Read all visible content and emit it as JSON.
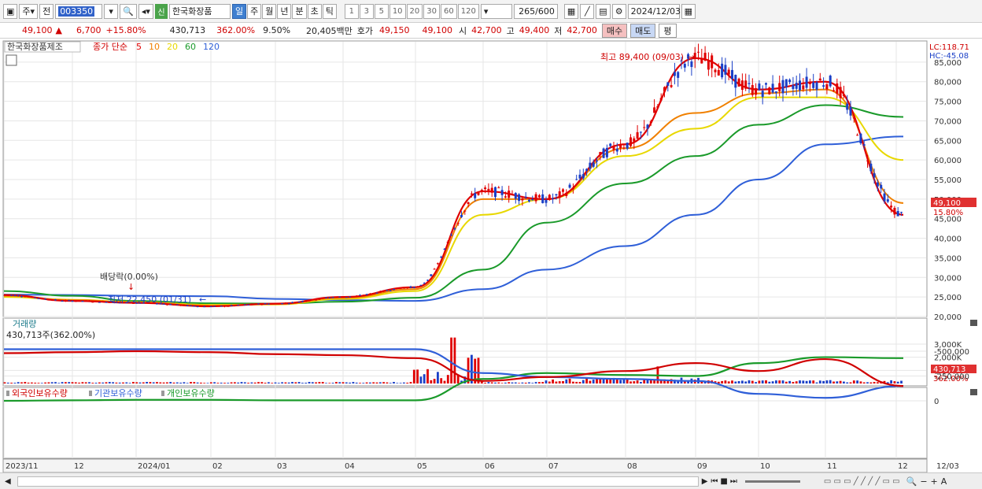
{
  "toolbar": {
    "code_prefix": "주",
    "all_label": "전",
    "code": "003350",
    "new_badge": "신",
    "stock_name": "한국화장품",
    "periods": [
      "일",
      "주",
      "월",
      "년",
      "분",
      "초",
      "틱"
    ],
    "selected_period": 0,
    "intervals": [
      "1",
      "3",
      "5",
      "10",
      "20",
      "30",
      "60",
      "120"
    ],
    "count": "265",
    "count_max": "/600",
    "date": "2024/12/03"
  },
  "quote": {
    "price": "49,100",
    "arrow": "▲",
    "change": "6,700",
    "change_pct": "+15.80%",
    "volume": "430,713",
    "volume_pct": "362.00%",
    "turnover_pct": "9.50%",
    "trade_value": "20,405백만",
    "ask_label": "호가",
    "ask": "49,150",
    "bid": "49,100",
    "open_label": "시",
    "open": "42,700",
    "high_label": "고",
    "high": "49,400",
    "low_label": "저",
    "low": "42,700",
    "buy_label": "매수",
    "sell_label": "매도",
    "eval_label": "평"
  },
  "price_panel": {
    "stock_label": "한국화장품제조",
    "ma_label": "종가 단순",
    "ma_periods": [
      {
        "p": "5",
        "color": "#e00000"
      },
      {
        "p": "10",
        "color": "#f08000"
      },
      {
        "p": "20",
        "color": "#e8d800"
      },
      {
        "p": "60",
        "color": "#1a9a2a"
      },
      {
        "p": "120",
        "color": "#2f5fd8"
      }
    ],
    "lc": "LC:118.71",
    "hc": "HC:-45.08",
    "high_note": "최고 89,400 (09/03)",
    "low_note": "최저 22,450 (01/31)",
    "dividend_note": "배당락(0.00%)",
    "y_ticks": [
      "85,000",
      "80,000",
      "75,000",
      "70,000",
      "65,000",
      "60,000",
      "55,000",
      "50,000",
      "45,000",
      "40,000",
      "35,000",
      "30,000",
      "25,000",
      "20,000"
    ],
    "last_price_tag": "49,100",
    "last_pct_tag": "15.80%"
  },
  "volume_panel": {
    "title": "거래량",
    "value": "430,713주(362.00%)",
    "y_ticks": [
      "3,000K",
      "2,000K",
      "1,000K"
    ],
    "last_tag": "430,713",
    "last_pct": "362.00%"
  },
  "holder_panel": {
    "labels": [
      {
        "name": "외국인보유수량",
        "color": "#d00000"
      },
      {
        "name": "기관보유수량",
        "color": "#2f5fd8"
      },
      {
        "name": "개인보유수량",
        "color": "#1a9a2a"
      }
    ],
    "y_ticks": [
      "0",
      "-250,000",
      "-500,000"
    ]
  },
  "x_axis": [
    "2023/11",
    "12",
    "2024/01",
    "02",
    "03",
    "04",
    "05",
    "06",
    "07",
    "08",
    "09",
    "10",
    "11",
    "12",
    "12/03"
  ],
  "chart_data": {
    "type": "line",
    "title": "",
    "x": [
      "2023/11",
      "12",
      "2024/01",
      "02",
      "03",
      "04",
      "05",
      "06",
      "07",
      "08",
      "09",
      "10",
      "11",
      "12"
    ],
    "series": [
      {
        "name": "5",
        "values": [
          25500,
          24000,
          23500,
          22600,
          23300,
          25000,
          27500,
          52000,
          50000,
          64000,
          86000,
          78000,
          80000,
          46000
        ]
      },
      {
        "name": "10",
        "values": [
          25300,
          24200,
          23600,
          22800,
          23200,
          24800,
          27000,
          50000,
          50000,
          63000,
          72000,
          77000,
          78000,
          49000
        ]
      },
      {
        "name": "20",
        "values": [
          25000,
          24300,
          23700,
          23000,
          23100,
          24500,
          26500,
          46000,
          50000,
          61000,
          68000,
          76000,
          76000,
          60000
        ]
      },
      {
        "name": "60",
        "values": [
          26500,
          25300,
          24000,
          23400,
          23300,
          23800,
          24800,
          32000,
          44000,
          54000,
          61000,
          69000,
          74000,
          71000
        ]
      },
      {
        "name": "120",
        "values": [
          25600,
          25500,
          25300,
          25200,
          24500,
          24200,
          24000,
          27000,
          32000,
          38000,
          46000,
          55000,
          64000,
          66000
        ]
      }
    ],
    "ylim": [
      20000,
      89400
    ]
  }
}
